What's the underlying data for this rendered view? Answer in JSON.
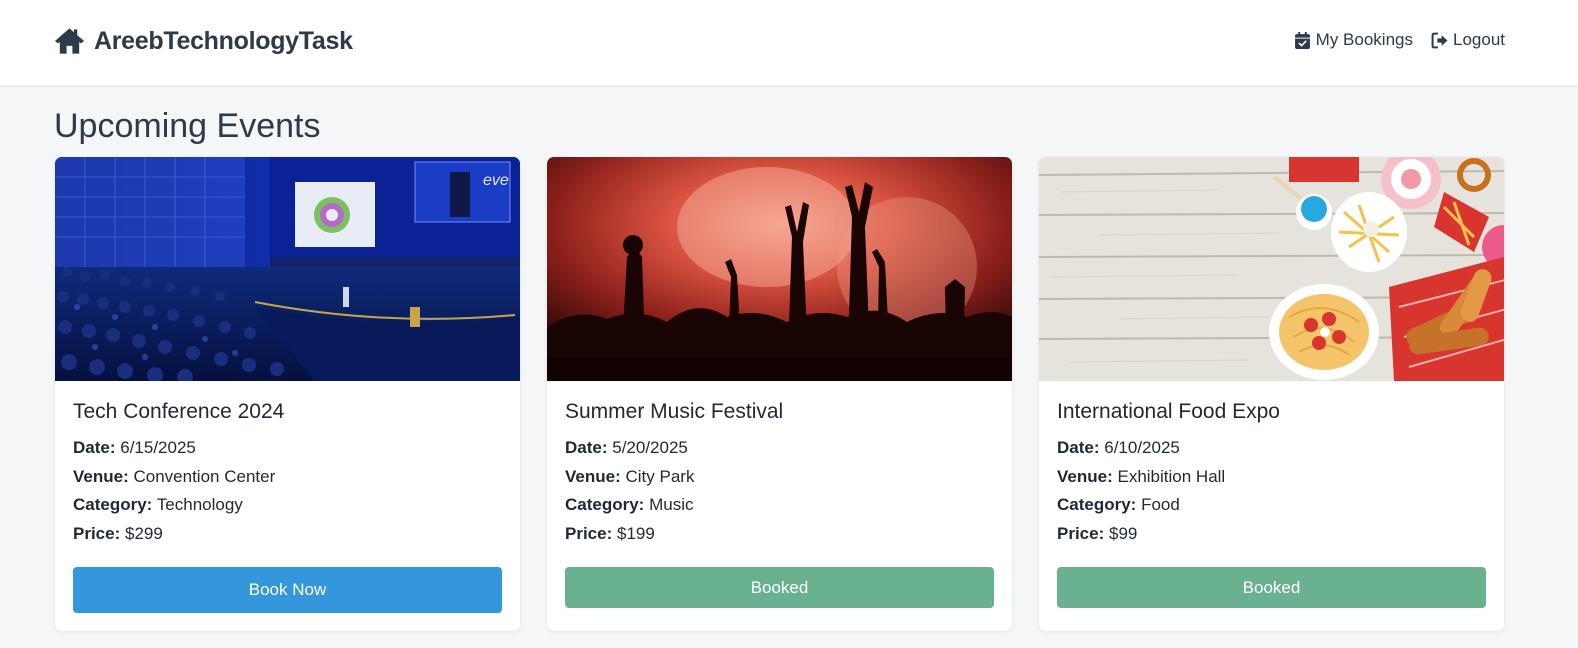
{
  "navbar": {
    "brand": "AreebTechnologyTask",
    "links": [
      {
        "label": "My Bookings",
        "icon": "calendar-check-icon"
      },
      {
        "label": "Logout",
        "icon": "sign-out-icon"
      }
    ]
  },
  "page": {
    "title": "Upcoming Events"
  },
  "labels": {
    "date": "Date:",
    "venue": "Venue:",
    "category": "Category:",
    "price": "Price:"
  },
  "events": [
    {
      "title": "Tech Conference 2024",
      "date": "6/15/2025",
      "venue": "Convention Center",
      "category": "Technology",
      "price": "$299",
      "button": "Book Now",
      "status": "available"
    },
    {
      "title": "Summer Music Festival",
      "date": "5/20/2025",
      "venue": "City Park",
      "category": "Music",
      "price": "$199",
      "button": "Booked",
      "status": "booked"
    },
    {
      "title": "International Food Expo",
      "date": "6/10/2025",
      "venue": "Exhibition Hall",
      "category": "Food",
      "price": "$99",
      "button": "Booked",
      "status": "booked"
    }
  ],
  "colors": {
    "primary": "#3497db",
    "booked": "#6ab190",
    "text": "#2c3a4a",
    "background": "#f5f6f8"
  }
}
